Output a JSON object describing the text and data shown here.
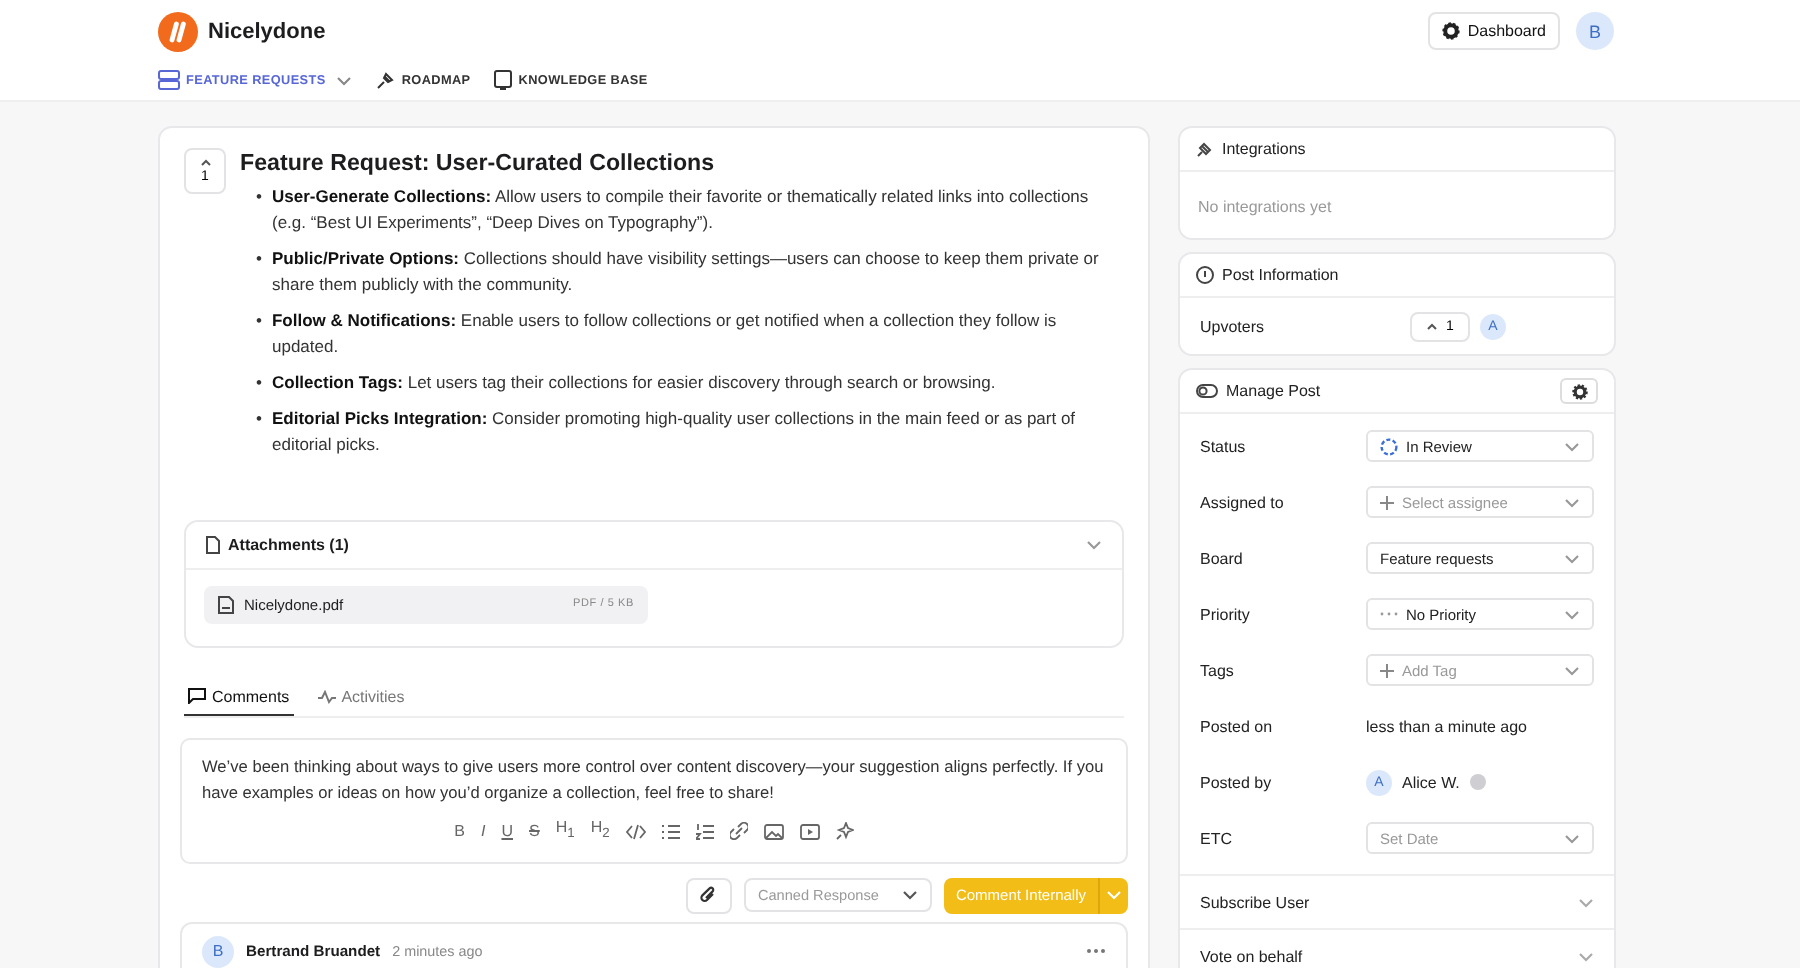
{
  "app": {
    "name": "Nicelydone"
  },
  "nav": [
    {
      "label": "FEATURE REQUESTS",
      "selected": true
    },
    {
      "label": "ROADMAP",
      "selected": false
    },
    {
      "label": "KNOWLEDGE BASE",
      "selected": false
    }
  ],
  "header": {
    "dashboard_button": "Dashboard",
    "avatar": "B"
  },
  "post": {
    "votes": "1",
    "title": "Feature Request: User-Curated Collections",
    "bullets": [
      {
        "marker": "•",
        "text": "**User-Generate Collections:** Allow users to compile their favorite or thematically related links into collections (e.g. “Best UI Experiments”, “Deep Dives on Typography”)."
      },
      {
        "marker": "•",
        "text": "**Public/Private Options:** Collections should have visibility settings—users can choose to keep them private or share them publicly with the community."
      },
      {
        "marker": "•",
        "text": "**Follow & Notifications:** Enable users to follow collections or get notified when a collection they follow is updated."
      },
      {
        "marker": "•",
        "text": "**Collection Tags:** Let users tag their collections for easier discovery through search or browsing."
      },
      {
        "marker": "•",
        "text": "**Editorial Picks Integration:** Consider promoting high-quality user collections in the main feed or as part of editorial picks."
      }
    ]
  },
  "attachments": {
    "title": "Attachments (1)",
    "files": [
      {
        "name": "Nicelydone.pdf",
        "meta": "PDF / 5 KB"
      }
    ]
  },
  "tabs": [
    {
      "label": "Comments",
      "selected": true
    },
    {
      "label": "Activities",
      "selected": false
    }
  ],
  "editor": {
    "value": "We’ve been thinking about ways to give users more control over content discovery—your suggestion aligns perfectly. If you have examples or ideas on how you’d organize a collection, feel free to share!",
    "toolbar": [
      {
        "kind": "bold",
        "label": "B"
      },
      {
        "kind": "italic",
        "label": "I"
      },
      {
        "kind": "underline",
        "label": "U"
      },
      {
        "kind": "strike",
        "label": "S"
      },
      {
        "kind": "heading",
        "label": "H$_{1}$"
      },
      {
        "kind": "heading",
        "label": "H$_{2}$"
      },
      {
        "kind": "code"
      },
      {
        "kind": "bullet-list"
      },
      {
        "kind": "ordered-list"
      },
      {
        "kind": "link"
      },
      {
        "kind": "image"
      },
      {
        "kind": "video"
      },
      {
        "kind": "magic"
      }
    ]
  },
  "actions": {
    "canned": "Canned Response",
    "submit": "Comment Internally"
  },
  "comments": [
    {
      "avatar": "B",
      "author": "Bertrand Bruandet",
      "time": "2 minutes ago"
    }
  ],
  "integrations": {
    "title": "Integrations",
    "empty": "No integrations yet"
  },
  "post_info": {
    "title": "Post Information",
    "upvoters_label": "Upvoters",
    "upvote_count": "1",
    "upvoters": [
      "A"
    ]
  },
  "manage": {
    "title": "Manage Post",
    "fields": [
      {
        "kind": "status",
        "label": "Status",
        "value": "In Review"
      },
      {
        "kind": "assignee",
        "label": "Assigned to",
        "placeholder": "Select assignee"
      },
      {
        "kind": "select",
        "label": "Board",
        "value": "Feature requests"
      },
      {
        "kind": "priority",
        "label": "Priority",
        "value": "No Priority"
      },
      {
        "kind": "tags",
        "label": "Tags",
        "placeholder": "Add Tag"
      },
      {
        "kind": "text",
        "label": "Posted on",
        "value": "less than a minute ago"
      },
      {
        "kind": "user",
        "label": "Posted by",
        "avatar": "A",
        "value": "Alice W."
      },
      {
        "kind": "date",
        "label": "ETC",
        "placeholder": "Set Date"
      }
    ],
    "sections": [
      "Subscribe User",
      "Vote on behalf"
    ]
  }
}
